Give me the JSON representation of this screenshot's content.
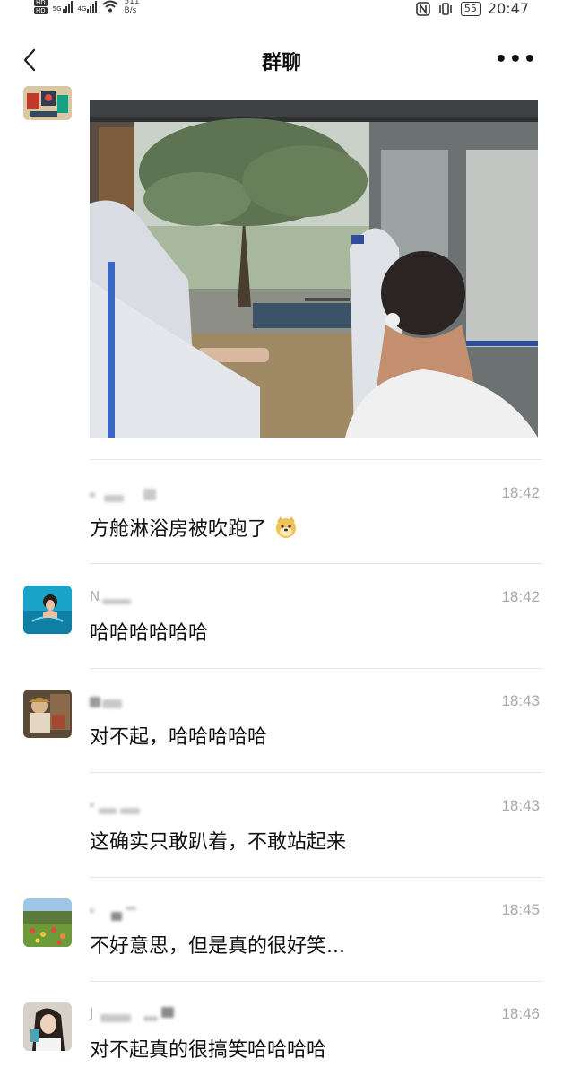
{
  "status_bar": {
    "network_labels": [
      "5G",
      "4G"
    ],
    "speed_value": "511",
    "speed_unit": "B/s",
    "battery": "55",
    "time": "20:47",
    "icons": [
      "nfc-icon",
      "vibrate-icon"
    ]
  },
  "header": {
    "title": "群聊",
    "more_label": "•••"
  },
  "messages": [
    {
      "time": "18:42",
      "text": "方舱淋浴房被吹跑了"
    },
    {
      "time": "18:42",
      "text": "哈哈哈哈哈哈"
    },
    {
      "time": "18:43",
      "text": "对不起，哈哈哈哈哈"
    },
    {
      "time": "18:43",
      "text": "这确实只敢趴着，不敢站起来"
    },
    {
      "time": "18:45",
      "text": "不好意思，但是真的很好笑..."
    },
    {
      "time": "18:46",
      "text": "对不起真的很搞笑哈哈哈哈"
    }
  ]
}
